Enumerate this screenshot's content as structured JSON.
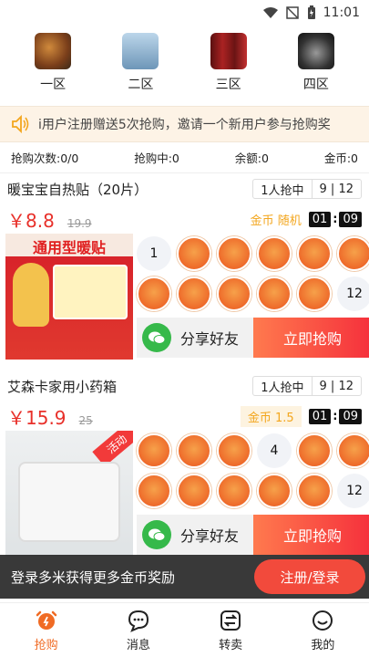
{
  "status_bar": {
    "time": "11:01"
  },
  "categories": [
    {
      "label": "一区",
      "icon": "food-platter-icon"
    },
    {
      "label": "二区",
      "icon": "appliance-icon"
    },
    {
      "label": "三区",
      "icon": "wine-icon"
    },
    {
      "label": "四区",
      "icon": "cookware-icon"
    }
  ],
  "notice": {
    "text": "i用户注册赠送5次抢购，邀请一个新用户参与抢购奖"
  },
  "stats": {
    "count": "抢购次数:0/0",
    "in_progress": "抢购中:0",
    "balance": "余额:0",
    "coins": "金币:0"
  },
  "products": [
    {
      "name": "暖宝宝自热贴（20片）",
      "pill_left": "1人抢中",
      "pill_right": "9 | 12",
      "price": "￥8.8",
      "orig": "19.9",
      "coin_tag": "金币 随机",
      "timer_m": "01",
      "timer_s": "09",
      "image_text": "通用型暖贴",
      "nums": [
        "1",
        "12"
      ],
      "share": "分享好友",
      "buy": "立即抢购"
    },
    {
      "name": "艾森卡家用小药箱",
      "pill_left": "1人抢中",
      "pill_right": "9 | 12",
      "price": "￥15.9",
      "orig": "25",
      "coin_tag": "金币 1.5",
      "timer_m": "01",
      "timer_s": "09",
      "image_text": "活动",
      "nums": [
        "4",
        "12"
      ],
      "share": "分享好友",
      "buy": "立即抢购"
    }
  ],
  "toast": {
    "text": "登录多米获得更多金币奖励",
    "button": "注册/登录"
  },
  "tabbar": [
    {
      "label": "抢购",
      "active": true
    },
    {
      "label": "消息"
    },
    {
      "label": "转卖"
    },
    {
      "label": "我的"
    }
  ],
  "colors": {
    "accent": "#f06b24",
    "price": "#e8302a",
    "coin": "#f3a61e"
  }
}
